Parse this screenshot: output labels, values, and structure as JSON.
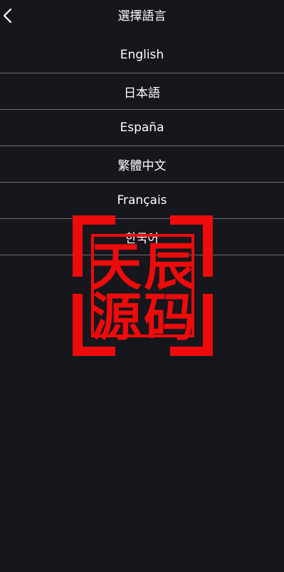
{
  "header": {
    "title": "選擇語言",
    "back_icon": "chevron-left-icon"
  },
  "languages": [
    {
      "label": "English"
    },
    {
      "label": "日本語"
    },
    {
      "label": "España"
    },
    {
      "label": "繁體中文"
    },
    {
      "label": "Français"
    },
    {
      "label": "한국어"
    }
  ],
  "watermark": {
    "text": "天辰源码",
    "color": "#ee0b0b"
  },
  "colors": {
    "background": "#16171c",
    "divider": "#6a6b70",
    "text": "#ffffff"
  }
}
